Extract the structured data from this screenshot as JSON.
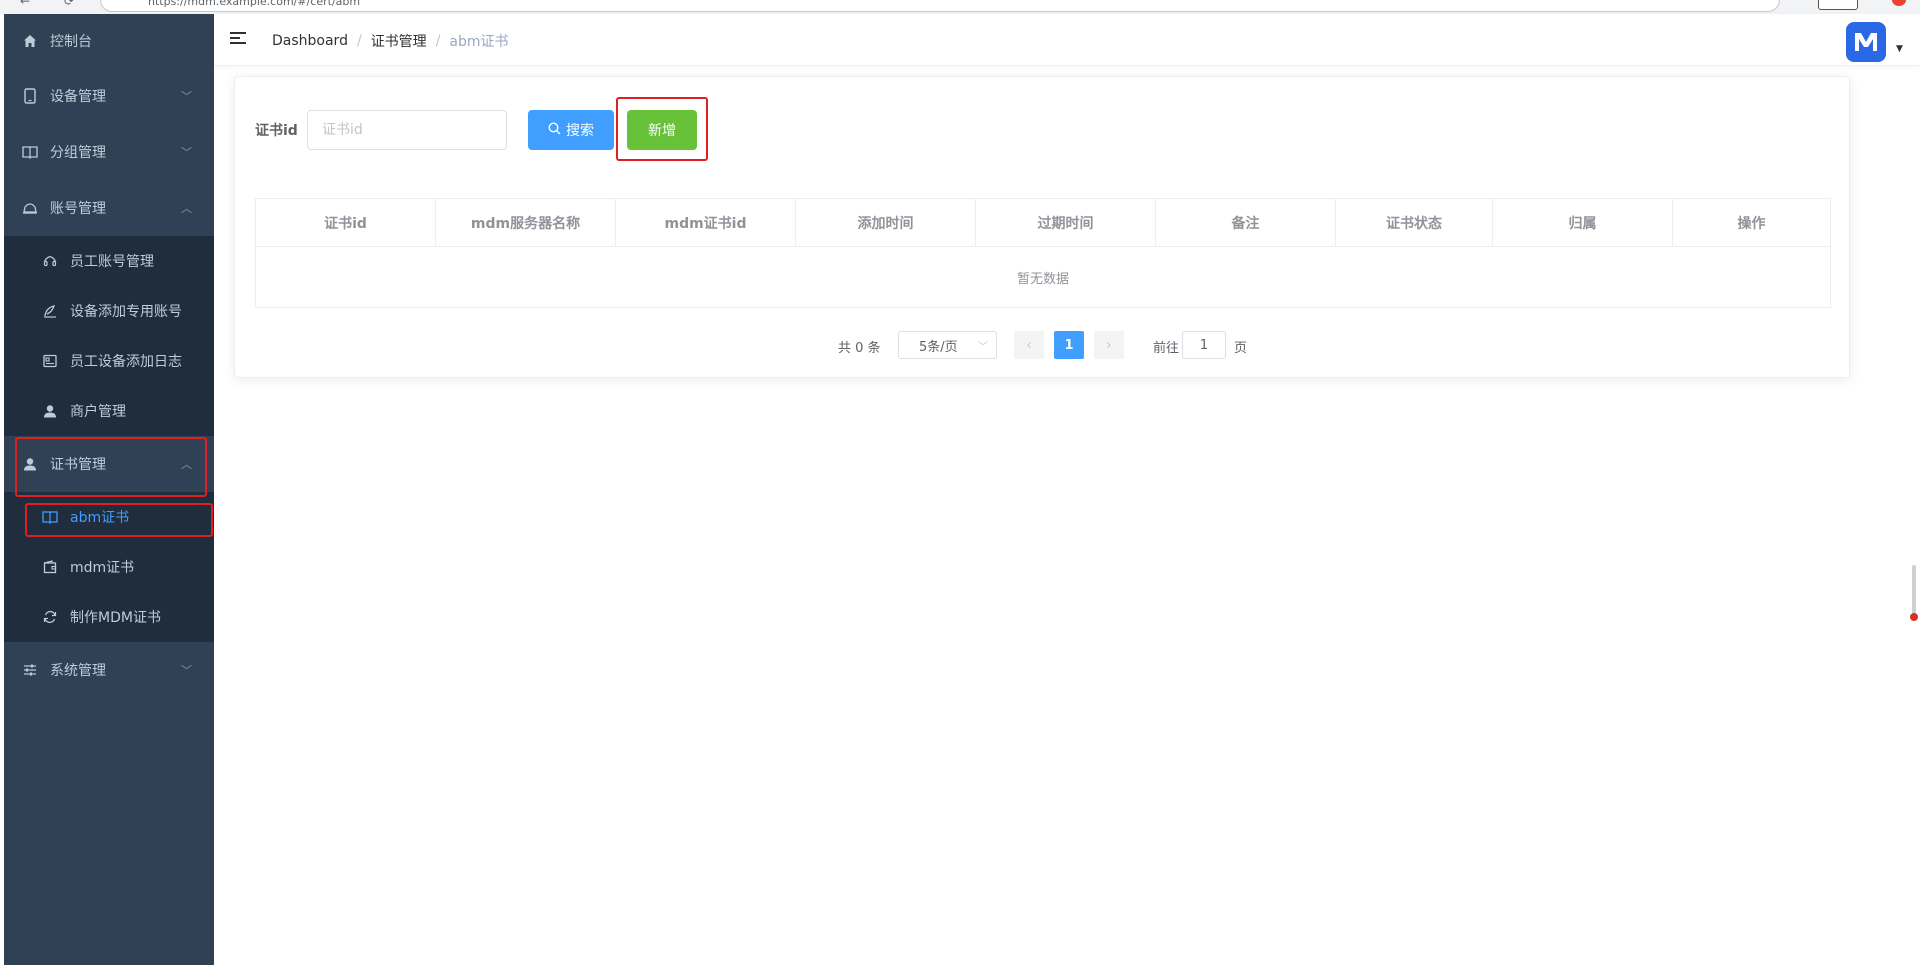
{
  "browser": {
    "url": "https://mdm.example.com/#/cert/abm"
  },
  "sidebar": {
    "items": [
      {
        "label": "控制台",
        "icon": "home-icon"
      },
      {
        "label": "设备管理",
        "icon": "tablet-icon"
      },
      {
        "label": "分组管理",
        "icon": "book-icon"
      },
      {
        "label": "账号管理",
        "icon": "bell-icon"
      },
      {
        "label": "证书管理",
        "icon": "user-icon"
      },
      {
        "label": "系统管理",
        "icon": "sliders-icon"
      }
    ],
    "account_sub": [
      {
        "label": "员工账号管理",
        "icon": "headset-icon"
      },
      {
        "label": "设备添加专用账号",
        "icon": "feather-icon"
      },
      {
        "label": "员工设备添加日志",
        "icon": "id-card-icon"
      },
      {
        "label": "商户管理",
        "icon": "user-icon"
      }
    ],
    "cert_sub": [
      {
        "label": "abm证书",
        "icon": "book-icon",
        "active": true
      },
      {
        "label": "mdm证书",
        "icon": "wallet-icon"
      },
      {
        "label": "制作MDM证书",
        "icon": "refresh-icon"
      }
    ]
  },
  "header": {
    "breadcrumb": [
      "Dashboard",
      "证书管理",
      "abm证书"
    ]
  },
  "filter": {
    "label": "证书id",
    "placeholder": "证书id",
    "search_label": "搜索",
    "add_label": "新增"
  },
  "table": {
    "columns": [
      "证书id",
      "mdm服务器名称",
      "mdm证书id",
      "添加时间",
      "过期时间",
      "备注",
      "证书状态",
      "归属",
      "操作"
    ],
    "empty_text": "暂无数据"
  },
  "pagination": {
    "total_text": "共 0 条",
    "page_size": "5条/页",
    "current_page": "1",
    "goto_label": "前往",
    "goto_value": "1",
    "page_unit": "页"
  },
  "colors": {
    "sidebar_bg": "#304156",
    "submenu_bg": "#1f2d3d",
    "primary": "#409eff",
    "success": "#67c23a",
    "annotation": "#e02020"
  }
}
